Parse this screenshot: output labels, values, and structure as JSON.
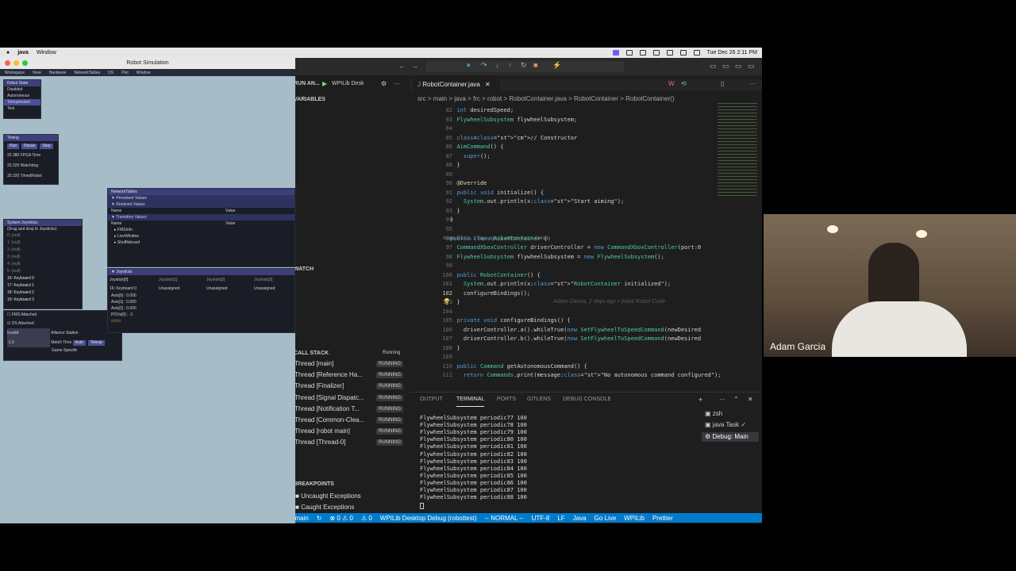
{
  "menubar": {
    "app": "java",
    "items": [
      "Window"
    ],
    "clock": "Tue Dec 26  2:11 PM"
  },
  "sim": {
    "title": "Robot Simulation",
    "menu": [
      "Workspace",
      "View",
      "Hardware",
      "NetworkTables",
      "DS",
      "Plot",
      "Window"
    ],
    "robot_state": {
      "title": "Robot State",
      "items": [
        "Disabled",
        "Autonomous",
        "Teleoperated",
        "Test"
      ]
    },
    "timing": {
      "title": "Timing",
      "buttons": [
        "Run",
        "Pause",
        "Step"
      ],
      "rows": [
        "32.380  FPGA Time",
        "33.325  Watchdog",
        "33.320  TimedRobot"
      ]
    },
    "joysticks_sys": {
      "title": "System Joysticks",
      "hint": "(Drag and drop to Joysticks)",
      "rows": [
        "0: (null)",
        "1: (null)",
        "2: (null)",
        "3: (null)",
        "4: (null)",
        "5: (null)",
        "16: Keyboard 0",
        "17: Keyboard 1",
        "18: Keyboard 2",
        "19: Keyboard 3"
      ]
    },
    "fms": {
      "rows": [
        "FMS Attached",
        "DS Attached"
      ],
      "alliance_value": "Invalid",
      "alliance_label": "Alliance Station",
      "match_time_value": "-1.0",
      "match_time_label": "Match Time",
      "auto": "Auto",
      "teleop": "Teleop",
      "game_specific": "Game Specific"
    },
    "network_tables": {
      "title": "NetworkTables",
      "persistent": "Persistent Values",
      "retained": "Retained Values",
      "transitory": "Transitory Values",
      "col_name": "Name",
      "col_value": "Value",
      "items": [
        "FMSInfo",
        "LiveWindow",
        "Shuffleboard"
      ]
    },
    "joysticks": {
      "title": "Joysticks",
      "cols": [
        "Joystick[0]",
        "Joystick[1]",
        "Joystick[2]",
        "Joystick[3]"
      ],
      "assign": [
        "16: Keyboard 0",
        "Unassigned",
        "Unassigned",
        "Unassigned"
      ],
      "axes": [
        "Axis[0] : 0.000",
        "Axis[1] : 0.000",
        "Axis[2] : 0.000",
        "POVs[0] : -1"
      ]
    }
  },
  "debug": {
    "run_label": "RUN AN...",
    "config": "WPILib Desk",
    "variables": "VARIABLES",
    "watch": "WATCH",
    "call_stack": "CALL STACK",
    "call_status": "Running",
    "threads": [
      {
        "name": "Thread [main]",
        "status": "RUNNING"
      },
      {
        "name": "Thread [Reference Ha...",
        "status": "RUNNING"
      },
      {
        "name": "Thread [Finalizer]",
        "status": "RUNNING"
      },
      {
        "name": "Thread [Signal Dispatc...",
        "status": "RUNNING"
      },
      {
        "name": "Thread [Notification T...",
        "status": "RUNNING"
      },
      {
        "name": "Thread [Common-Clea...",
        "status": "RUNNING"
      },
      {
        "name": "Thread [robot main]",
        "status": "RUNNING"
      },
      {
        "name": "Thread [Thread-0]",
        "status": "RUNNING"
      }
    ],
    "breakpoints": "BREAKPOINTS",
    "bp_items": [
      "Uncaught Exceptions",
      "Caught Exceptions"
    ]
  },
  "editor": {
    "tab": "RobotContainer.java",
    "breadcrumb": "src > main > java > frc > robot > RobotContainer.java > RobotContainer > RobotContainer()",
    "blame": "Adam Garcia, 2 days ago | 1 author (Adam Garcia)",
    "inline_blame": "Adam Garcia, 2 days ago • Initial Robot Code",
    "lines": [
      {
        "n": "82",
        "t": "  int desiredSpeed;"
      },
      {
        "n": "83",
        "t": "  FlywheelSubsystem flywheelSubsystem;"
      },
      {
        "n": "84",
        "t": ""
      },
      {
        "n": "85",
        "t": "  // Constructor"
      },
      {
        "n": "86",
        "t": "  AimCommand() {"
      },
      {
        "n": "87",
        "t": "    super();"
      },
      {
        "n": "88",
        "t": "  }"
      },
      {
        "n": "89",
        "t": ""
      },
      {
        "n": "90",
        "t": "  @Override"
      },
      {
        "n": "91",
        "t": "  public void initialize() {"
      },
      {
        "n": "92",
        "t": "    System.out.println(x:\"Start aiming\");"
      },
      {
        "n": "93",
        "t": "  }"
      },
      {
        "n": "94",
        "t": "}"
      },
      {
        "n": "95",
        "t": ""
      },
      {
        "n": "96",
        "t": "public class RobotContainer {"
      },
      {
        "n": "97",
        "t": "  CommandXboxController driverController = new CommandXboxController(port:0"
      },
      {
        "n": "98",
        "t": "  FlywheelSubsystem flywheelSubsystem = new FlywheelSubsystem();"
      },
      {
        "n": "99",
        "t": ""
      },
      {
        "n": "100",
        "t": "  public RobotContainer() {"
      },
      {
        "n": "101",
        "t": "    System.out.println(x:\"RobotContainer initialized\");"
      },
      {
        "n": "102",
        "t": "    configureBindings();"
      },
      {
        "n": "103",
        "t": "  }"
      },
      {
        "n": "104",
        "t": ""
      },
      {
        "n": "105",
        "t": "  private void configureBindings() {"
      },
      {
        "n": "106",
        "t": "    driverController.a().whileTrue(new SetFlywheelToSpeedCommand(newDesired"
      },
      {
        "n": "107",
        "t": "    driverController.b().whileTrue(new SetFlywheelToSpeedCommand(newDesired"
      },
      {
        "n": "108",
        "t": "  }"
      },
      {
        "n": "109",
        "t": ""
      },
      {
        "n": "110",
        "t": "  public Command getAutonomousCommand() {"
      },
      {
        "n": "111",
        "t": "    return Commands.print(message:\"No autonomous command configured\");"
      }
    ]
  },
  "terminal": {
    "tabs": [
      "OUTPUT",
      "TERMINAL",
      "PORTS",
      "GITLENS",
      "DEBUG CONSOLE"
    ],
    "lines": [
      "FlywheelSubsystem periodic77 100",
      "FlywheelSubsystem periodic78 100",
      "FlywheelSubsystem periodic79 100",
      "FlywheelSubsystem periodic80 100",
      "FlywheelSubsystem periodic81 100",
      "FlywheelSubsystem periodic82 100",
      "FlywheelSubsystem periodic83 100",
      "FlywheelSubsystem periodic84 100",
      "FlywheelSubsystem periodic85 100",
      "FlywheelSubsystem periodic86 100",
      "FlywheelSubsystem periodic87 100",
      "FlywheelSubsystem periodic88 100"
    ],
    "sessions": [
      "zsh",
      "java  Task",
      "Debug: Main"
    ]
  },
  "status": {
    "branch": "main",
    "errors": "⊗ 0 ⚠ 0",
    "warn": "⚠ 0",
    "debug": "WPILib Desktop Debug (robottest)",
    "mode": "-- NORMAL --",
    "encoding": "UTF-8",
    "eol": "LF",
    "lang": "Java",
    "golive": "Go Live",
    "wpilib": "WPILib",
    "prettier": "Prettier"
  },
  "webcam": {
    "name": "Adam Garcia"
  }
}
